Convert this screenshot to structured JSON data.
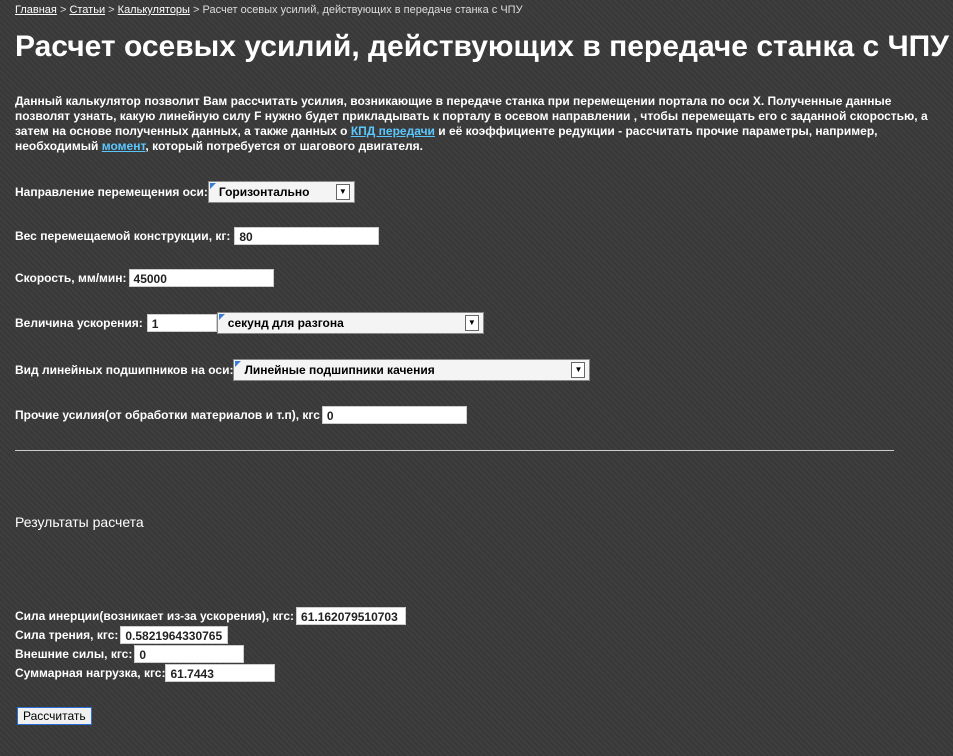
{
  "breadcrumb": {
    "items": [
      "Главная",
      "Статьи",
      "Калькуляторы"
    ],
    "separator": ">",
    "current": "Расчет осевых усилий, действующих в передаче станка с ЧПУ"
  },
  "page_title": "Расчет осевых усилий, действующих в передаче станка с ЧПУ",
  "intro": {
    "text_1": "Данный калькулятор позволит Вам рассчитать усилия, возникающие в передаче станка при перемещении портала по оси Х. Полученные данные позволят узнать, какую линейную силу F нужно будет прикладывать к порталу в осевом направлении , чтобы перемещать его с заданной скоростью, а затем на основе полученных данных, а также данных о ",
    "link_1": "КПД передачи",
    "text_2": " и её коэффициенте редукции - рассчитать прочие параметры, например, необходимый ",
    "link_2": "момент",
    "text_3": ", который потребуется от шагового двигателя."
  },
  "form": {
    "direction": {
      "label": "Направление перемещения оси:",
      "value": "Горизонтально"
    },
    "weight": {
      "label": "Вес перемещаемой конструкции, кг:",
      "value": "80"
    },
    "speed": {
      "label": "Скорость, мм/мин:",
      "value": "45000"
    },
    "acceleration": {
      "label": "Величина ускорения:",
      "value": "1",
      "unit_value": "секунд для разгона"
    },
    "bearings": {
      "label": "Вид линейных подшипников на оси:",
      "value": "Линейные подшипники качения"
    },
    "other_forces": {
      "label": "Прочие усилия(от обработки материалов и т.п), кгс",
      "value": "0"
    }
  },
  "results": {
    "title": "Результаты расчета",
    "inertia": {
      "label": "Сила инерции(возникает из-за ускорения), кгс:",
      "value": "61.162079510703"
    },
    "friction": {
      "label": "Сила трения, кгс:",
      "value": "0.5821964330765"
    },
    "external": {
      "label": "Внешние силы, кгс:",
      "value": "0"
    },
    "total": {
      "label": "Суммарная нагрузка, кгс:",
      "value": "61.7443"
    }
  },
  "calculate_button": "Рассчитать",
  "icons": {
    "select_arrow": "chevron-down-icon"
  },
  "colors": {
    "link": "#5ac8ff",
    "background": "#3a3a3a",
    "button_border": "#2a6fd6"
  }
}
